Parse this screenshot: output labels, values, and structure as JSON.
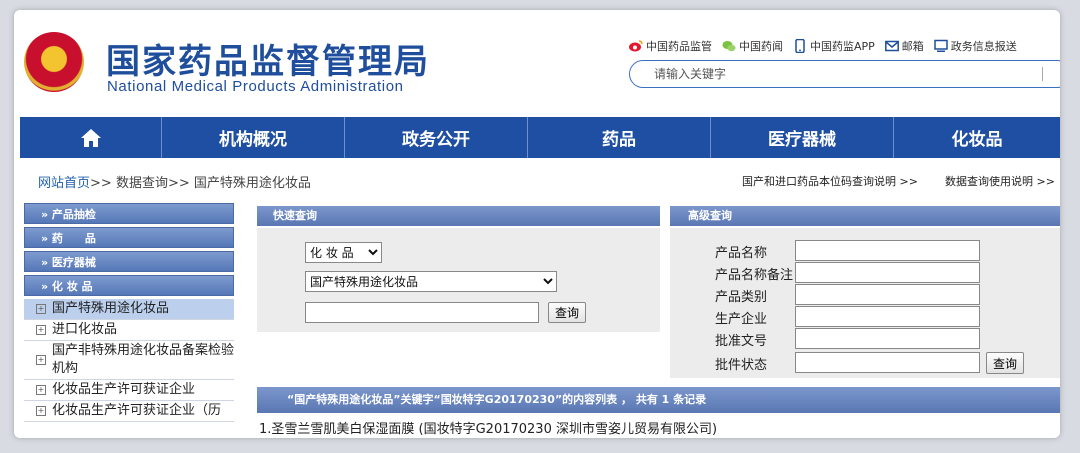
{
  "header": {
    "title_cn": "国家药品监督管理局",
    "title_en": "National Medical Products Administration",
    "links": [
      {
        "label": "中国药品监管",
        "icon": "weibo-icon"
      },
      {
        "label": "中国药闻",
        "icon": "wechat-icon"
      },
      {
        "label": "中国药监APP",
        "icon": "mobile-icon"
      },
      {
        "label": "邮箱",
        "icon": "mail-icon"
      },
      {
        "label": "政务信息报送",
        "icon": "monitor-icon"
      }
    ],
    "search_placeholder": "请输入关键字"
  },
  "nav": {
    "home_icon": "home-icon",
    "items": [
      "机构概况",
      "政务公开",
      "药品",
      "医疗器械",
      "化妆品"
    ]
  },
  "breadcrumb": {
    "home": "网站首页",
    "sep": ">>",
    "level1": "数据查询",
    "level2": "国产特殊用途化妆品"
  },
  "hints": {
    "left": "国产和进口药品本位码查询说明 >>",
    "right": "数据查询使用说明 >>"
  },
  "sidebar": {
    "categories": [
      "» 产品抽检",
      "» 药　　品",
      "» 医疗器械",
      "» 化 妆 品"
    ],
    "items": [
      "国产特殊用途化妆品",
      "进口化妆品",
      "国产非特殊用途化妆品备案检验机构",
      "化妆品生产许可获证企业",
      "化妆品生产许可获证企业（历"
    ]
  },
  "quick": {
    "title": "快速查询",
    "category_value": "化 妆 品",
    "subcategory_value": "国产特殊用途化妆品",
    "keyword_value": "",
    "button": "查询"
  },
  "advanced": {
    "title": "高级查询",
    "fields": [
      "产品名称",
      "产品名称备注",
      "产品类别",
      "生产企业",
      "批准文号",
      "批件状态"
    ],
    "button": "查询"
  },
  "results": {
    "summary": "“国产特殊用途化妆品”关键字“国妆特字G20170230”的内容列表 ， 共有 1 条记录",
    "rows": [
      "1.圣雪兰雪肌美白保湿面膜 (国妆特字G20170230 深圳市雪姿儿贸易有限公司)"
    ]
  }
}
